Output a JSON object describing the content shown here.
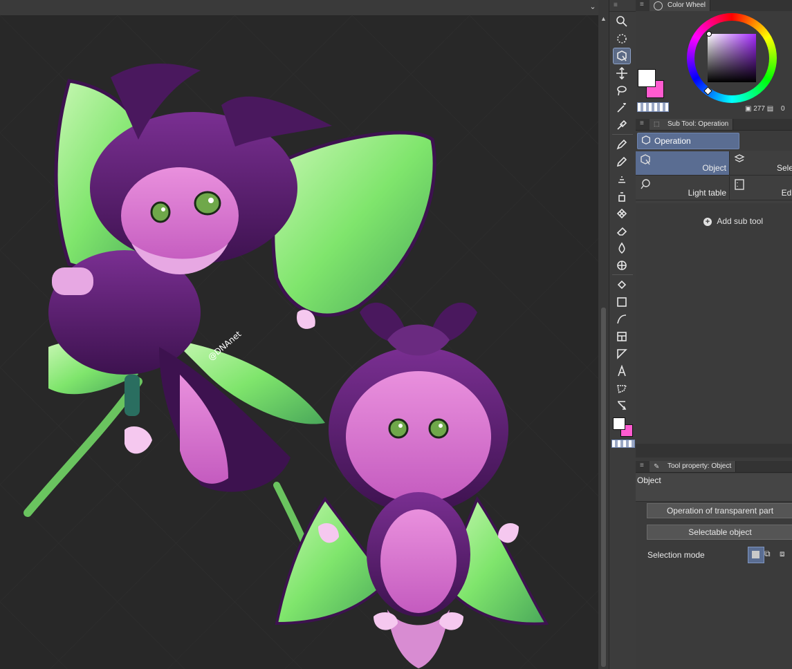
{
  "topbar": {
    "chevron": "⌄"
  },
  "color_wheel_panel": {
    "title": "Color Wheel",
    "value_left": "277",
    "value_right": "0"
  },
  "subtool_panel": {
    "title": "Sub Tool: Operation",
    "group_label": "Operation",
    "items": [
      {
        "label": "Object",
        "icon": "object-select-icon",
        "selected": true
      },
      {
        "label": "Sele",
        "icon": "select-layer-icon",
        "selected": false
      },
      {
        "label": "Light table",
        "icon": "light-table-icon",
        "selected": false
      },
      {
        "label": "Edi",
        "icon": "edit-timeline-icon",
        "selected": false
      }
    ],
    "add_label": "Add sub tool"
  },
  "tool_property_panel": {
    "title": "Tool property: Object",
    "name": "Object",
    "button1": "Operation of transparent part",
    "button2": "Selectable object",
    "selection_mode_label": "Selection mode"
  },
  "colors": {
    "main": "#ffffff",
    "sub": "#ff5bd0",
    "accent": "#5b6a85",
    "wing_green": "#7ee06a",
    "fur_purple": "#8d3b9a"
  },
  "signature": "@DNAnet"
}
